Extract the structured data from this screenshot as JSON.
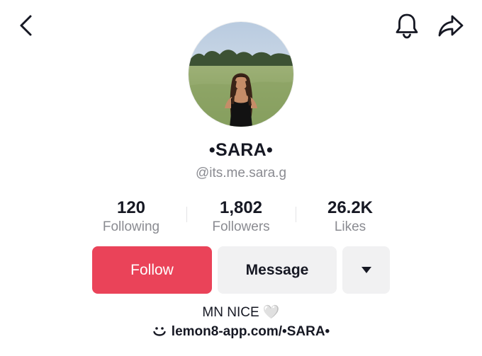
{
  "profile": {
    "display_name": "•SARA•",
    "handle": "@its.me.sara.g",
    "bio": "MN NICE 🤍",
    "link": "lemon8-app.com/•SARA•"
  },
  "stats": [
    {
      "value": "120",
      "label": "Following"
    },
    {
      "value": "1,802",
      "label": "Followers"
    },
    {
      "value": "26.2K",
      "label": "Likes"
    }
  ],
  "actions": {
    "follow_label": "Follow",
    "message_label": "Message"
  },
  "icons": {
    "back": "chevron-left-icon",
    "notifications": "bell-icon",
    "share": "share-arrow-icon",
    "more": "caret-down-icon",
    "link": "lemon8-smile-icon"
  },
  "colors": {
    "follow_button": "#ea4359",
    "secondary_button": "#f1f1f2",
    "muted_text": "#8a8b91",
    "primary_text": "#161823"
  }
}
